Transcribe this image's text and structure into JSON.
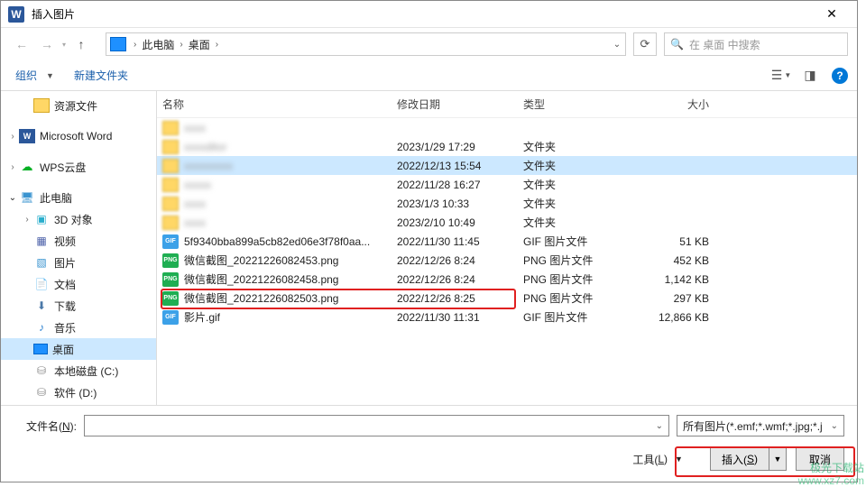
{
  "title": "插入图片",
  "path": {
    "loc1": "此电脑",
    "loc2": "桌面"
  },
  "search_placeholder": "在 桌面 中搜索",
  "toolbar": {
    "organize": "组织",
    "newfolder": "新建文件夹"
  },
  "columns": {
    "name": "名称",
    "date": "修改日期",
    "type": "类型",
    "size": "大小"
  },
  "tree": [
    {
      "label": "资源文件",
      "icon": "folder",
      "indent": 1,
      "chev": ""
    },
    {
      "label": "Microsoft Word",
      "icon": "word",
      "indent": 0,
      "chev": ">"
    },
    {
      "label": "WPS云盘",
      "icon": "cloud",
      "indent": 0,
      "chev": ">"
    },
    {
      "label": "此电脑",
      "icon": "pc",
      "indent": 0,
      "chev": "v"
    },
    {
      "label": "3D 对象",
      "icon": "obj3d",
      "indent": 1,
      "chev": ">"
    },
    {
      "label": "视频",
      "icon": "video",
      "indent": 1,
      "chev": ""
    },
    {
      "label": "图片",
      "icon": "pics",
      "indent": 1,
      "chev": ""
    },
    {
      "label": "文档",
      "icon": "docs",
      "indent": 1,
      "chev": ""
    },
    {
      "label": "下载",
      "icon": "down",
      "indent": 1,
      "chev": ""
    },
    {
      "label": "音乐",
      "icon": "music",
      "indent": 1,
      "chev": ""
    },
    {
      "label": "桌面",
      "icon": "desk",
      "indent": 1,
      "chev": "",
      "sel": true
    },
    {
      "label": "本地磁盘 (C:)",
      "icon": "drive",
      "indent": 1,
      "chev": ""
    },
    {
      "label": "软件 (D:)",
      "icon": "drive",
      "indent": 1,
      "chev": ""
    }
  ],
  "files": [
    {
      "name": "xxxx",
      "blur": true,
      "icon": "folder",
      "date": "",
      "type": "",
      "size": "",
      "sel": false
    },
    {
      "name": "xxxxditor",
      "blur": true,
      "icon": "folder",
      "date": "2023/1/29 17:29",
      "type": "文件夹",
      "size": "",
      "sel": false
    },
    {
      "name": "xxxxxxxxx",
      "blur": true,
      "icon": "folder",
      "date": "2022/12/13 15:54",
      "type": "文件夹",
      "size": "",
      "sel": true
    },
    {
      "name": "xxxxx",
      "blur": true,
      "icon": "folder",
      "date": "2022/11/28 16:27",
      "type": "文件夹",
      "size": "",
      "sel": false
    },
    {
      "name": "xxxx",
      "blur": true,
      "icon": "folder",
      "date": "2023/1/3 10:33",
      "type": "文件夹",
      "size": "",
      "sel": false
    },
    {
      "name": "xxxx",
      "blur": true,
      "icon": "folder",
      "date": "2023/2/10 10:49",
      "type": "文件夹",
      "size": "",
      "sel": false
    },
    {
      "name": "5f9340bba899a5cb82ed06e3f78f0aa...",
      "blur": false,
      "icon": "gif",
      "date": "2022/11/30 11:45",
      "type": "GIF 图片文件",
      "size": "51 KB",
      "sel": false
    },
    {
      "name": "微信截图_20221226082453.png",
      "blur": false,
      "icon": "png",
      "date": "2022/12/26 8:24",
      "type": "PNG 图片文件",
      "size": "452 KB",
      "sel": false
    },
    {
      "name": "微信截图_20221226082458.png",
      "blur": false,
      "icon": "png",
      "date": "2022/12/26 8:24",
      "type": "PNG 图片文件",
      "size": "1,142 KB",
      "sel": false
    },
    {
      "name": "微信截图_20221226082503.png",
      "blur": false,
      "icon": "png",
      "date": "2022/12/26 8:25",
      "type": "PNG 图片文件",
      "size": "297 KB",
      "sel": false
    },
    {
      "name": "影片.gif",
      "blur": false,
      "icon": "gif",
      "date": "2022/11/30 11:31",
      "type": "GIF 图片文件",
      "size": "12,866 KB",
      "sel": false
    }
  ],
  "bottom": {
    "fname_label_pre": "文件名(",
    "fname_label_u": "N",
    "fname_label_post": "):",
    "filter": "所有图片(*.emf;*.wmf;*.jpg;*.j",
    "tools_pre": "工具(",
    "tools_u": "L",
    "tools_post": ")",
    "insert_pre": "插入(",
    "insert_u": "S",
    "insert_post": ")",
    "cancel": "取消"
  },
  "watermark": {
    "l1": "极光下载站",
    "l2": "www.xz7.com"
  }
}
